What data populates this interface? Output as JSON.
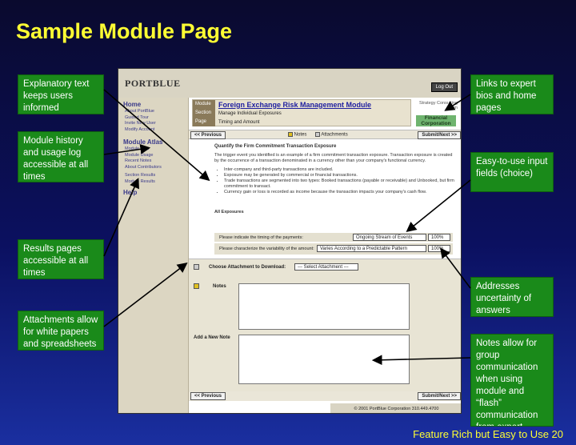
{
  "slide": {
    "title": "Sample Module Page",
    "footer": "Feature Rich but Easy to Use  20"
  },
  "callouts": {
    "explanatory": "Explanatory text keeps users informed",
    "history": "Module history and usage log accessible at all times",
    "results": "Results pages accessible at all times",
    "attachments": "Attachments allow for white papers and spreadsheets",
    "links": "Links to expert bios and home pages",
    "input": "Easy-to-use input fields (choice)",
    "uncertainty": "Addresses uncertainty of answers",
    "notes": "Notes allow for group communication when using module and “flash” communication from expert"
  },
  "app": {
    "logo": "PORTBLUE",
    "logout": "Log Out",
    "sidebar": {
      "home": "Home",
      "home_links": [
        "About PortBlue",
        "Guided Tour",
        "Invite New User",
        "Modify Account"
      ],
      "atlas": "Module Atlas",
      "atlas_links": [
        "Module Map",
        "Module Usage",
        "Recent Notes",
        "About Contributors"
      ],
      "results_links": [
        "Section Results",
        "Module Results"
      ],
      "help": "Help"
    },
    "module": {
      "module_label": "Module",
      "module_title": "Foreign Exchange Risk Management Module",
      "section_label": "Section",
      "section_value": "Manage Individual Exposures",
      "page_label": "Page",
      "page_value": "Timing and Amount"
    },
    "strategy": "Strategy Consulting Firm",
    "fincorp": "Financial Corporation",
    "nav": {
      "previous": "<< Previous",
      "notes": "Notes",
      "attachments": "Attachments",
      "submit": "Submit/Next >>"
    },
    "content": {
      "heading": "Quantify the Firm Commitment Transaction Exposure",
      "intro": "The trigger event you identified is an example of a firm commitment transaction exposure. Transaction exposure is created by the occurrence of a transaction denominated in a currency other than your company's functional currency.",
      "bullets": [
        "Inter-company and third-party transactions are included.",
        "Exposure may be generated by commercial or financial transactions.",
        "Trade transactions are segmented into two types: Booked transactions (payable or receivable) and Unbooked, but firm commitment to transact.",
        "Currency gain or loss is recorded as income because the transaction impacts your company's cash flow."
      ],
      "all_exposures": "All Exposures"
    },
    "questions": [
      {
        "label": "Please indicate the timing of the payments:",
        "value": "Ongoing Stream of Events",
        "pct": "100%"
      },
      {
        "label": "Please characterize the variability of the amount:",
        "value": "Varies According to a Predictable Pattern",
        "pct": "100%"
      }
    ],
    "attach": {
      "label": "Choose Attachment to Download:",
      "select": "--- Select Attachment ---",
      "notes_label": "Notes",
      "add_note": "Add a New Note"
    },
    "copyright": "© 2001 PortBlue Corporation 310.449.4700"
  },
  "colors": {
    "title": "#ffff33",
    "callout": "#1a8a1a",
    "background": "#0b1060"
  }
}
